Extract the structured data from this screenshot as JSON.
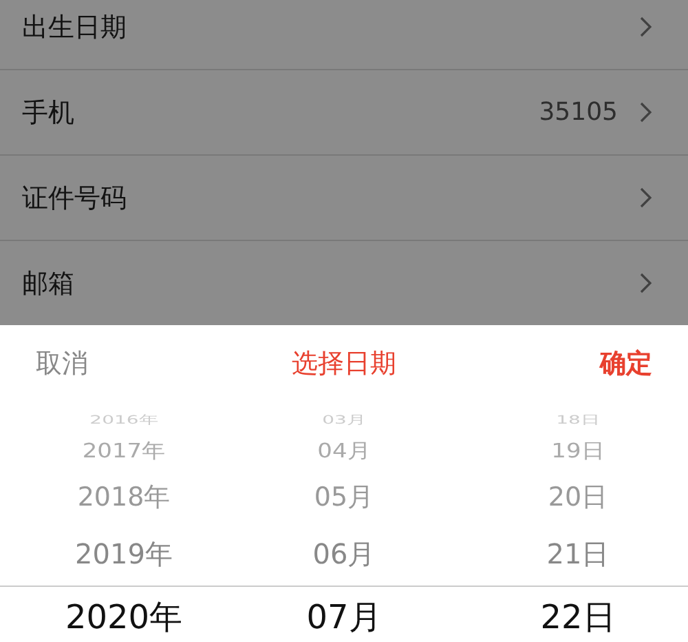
{
  "form_rows": [
    {
      "label": "出生日期"
    },
    {
      "label": "手机",
      "value": "35105"
    },
    {
      "label": "证件号码"
    },
    {
      "label": "邮箱"
    }
  ],
  "date_picker": {
    "cancel": "取消",
    "title": "选择日期",
    "confirm": "确定",
    "columns": [
      {
        "items": [
          {
            "label": "2016年",
            "selected": false
          },
          {
            "label": "2017年",
            "selected": false
          },
          {
            "label": "2018年",
            "selected": false
          },
          {
            "label": "2019年",
            "selected": false
          },
          {
            "label": "2020年",
            "selected": true
          }
        ]
      },
      {
        "items": [
          {
            "label": "03月",
            "selected": false
          },
          {
            "label": "04月",
            "selected": false
          },
          {
            "label": "05月",
            "selected": false
          },
          {
            "label": "06月",
            "selected": false
          },
          {
            "label": "07月",
            "selected": true
          }
        ]
      },
      {
        "items": [
          {
            "label": "18日",
            "selected": false
          },
          {
            "label": "19日",
            "selected": false
          },
          {
            "label": "20日",
            "selected": false
          },
          {
            "label": "21日",
            "selected": false
          },
          {
            "label": "22日",
            "selected": true
          }
        ]
      }
    ]
  }
}
